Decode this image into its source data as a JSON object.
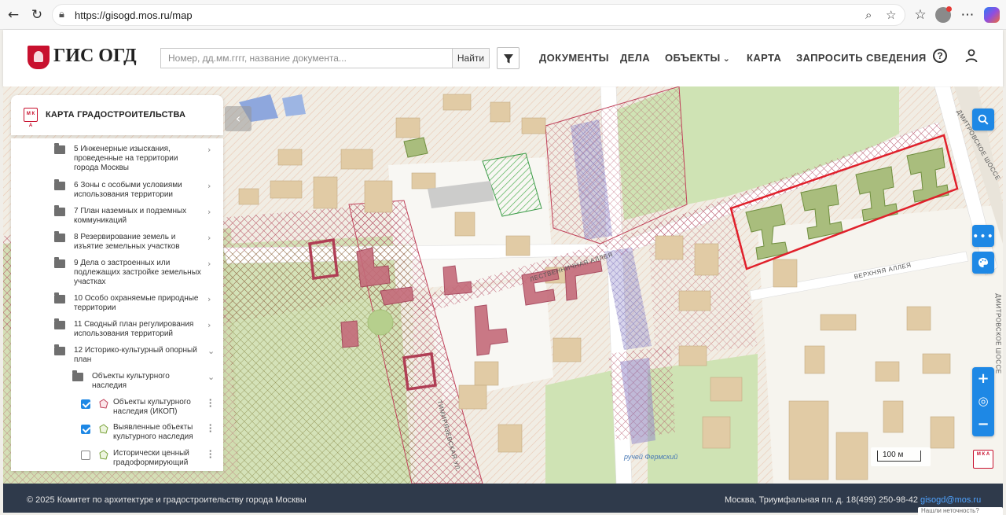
{
  "browser": {
    "url": "https://gisogd.mos.ru/map",
    "icons": [
      "back-icon",
      "reload-icon",
      "lock-icon",
      "zoom-icon",
      "star-icon",
      "favorites-icon",
      "profile-avatar",
      "more-icon",
      "copilot-icon"
    ]
  },
  "header": {
    "logo_text": "ГИС ОГД",
    "search_placeholder": "Номер, дд.мм.гггг, название документа...",
    "search_button": "Найти",
    "nav": {
      "documents": "ДОКУМЕНТЫ",
      "cases": "ДЕЛА",
      "objects": "ОБЪЕКТЫ",
      "map": "КАРТА",
      "request": "ЗАПРОСИТЬ СВЕДЕНИЯ"
    }
  },
  "panel": {
    "title": "КАРТА ГРАДОСТРОИТЕЛЬСТВА",
    "icon_text": "М К А",
    "layers": [
      {
        "label": "5 Инженерные изыскания, проведенные на территории города Москвы",
        "expanded": false
      },
      {
        "label": "6 Зоны с особыми условиями использования территории",
        "expanded": false
      },
      {
        "label": "7 План наземных и подземных коммуникаций",
        "expanded": false
      },
      {
        "label": "8 Резервирование земель и изъятие земельных участков",
        "expanded": false
      },
      {
        "label": "9 Дела о застроенных или подлежащих застройке земельных участках",
        "expanded": false
      },
      {
        "label": "10 Особо охраняемые природные территории",
        "expanded": false
      },
      {
        "label": "11 Сводный план регулирования использования территорий",
        "expanded": false
      },
      {
        "label": "12 Историко-культурный опорный план",
        "expanded": true
      }
    ],
    "sublayer": {
      "label": "Объекты культурного наследия",
      "expanded": true
    },
    "items": [
      {
        "label": "Объекты культурного наследия (ИКОП)",
        "checked": true,
        "color": "#c0415a"
      },
      {
        "label": "Выявленные объекты культурного наследия",
        "checked": true,
        "color": "#7aa33c"
      },
      {
        "label": "Исторически ценный градоформирующий",
        "checked": false,
        "color": "#7aa33c"
      }
    ]
  },
  "map": {
    "street_labels": {
      "alley": "ЛЕСТВЕННИЧНАЯ АЛЛЕЯ",
      "upper_alley": "ВЕРХНЯЯ АЛЛЕЯ",
      "dmitrov_1": "ДМИТРОВСКОЕ ШОССЕ",
      "dmitrov_2": "ДМИТРОВСКОЕ ШОССЕ",
      "vertical": "ТИМИРЯЗЕВСКАЯ УЛ."
    },
    "stream_label": "ручей Фермский",
    "scale": "100 м",
    "mka_badge": "М К А",
    "colors": {
      "heritage": "#c0415a",
      "identified": "#7aa33c",
      "selection": "#e0202b",
      "accent": "#1e88e5"
    }
  },
  "footer": {
    "copyright": "© 2025 Комитет по архитектуре и градостроительству города Москвы",
    "address": "Москва, Триумфальная пл. д. 1",
    "phone": "8(499) 250-98-42",
    "email": "gisogd@mos.ru",
    "cut_text": "Нашли неточность?"
  }
}
